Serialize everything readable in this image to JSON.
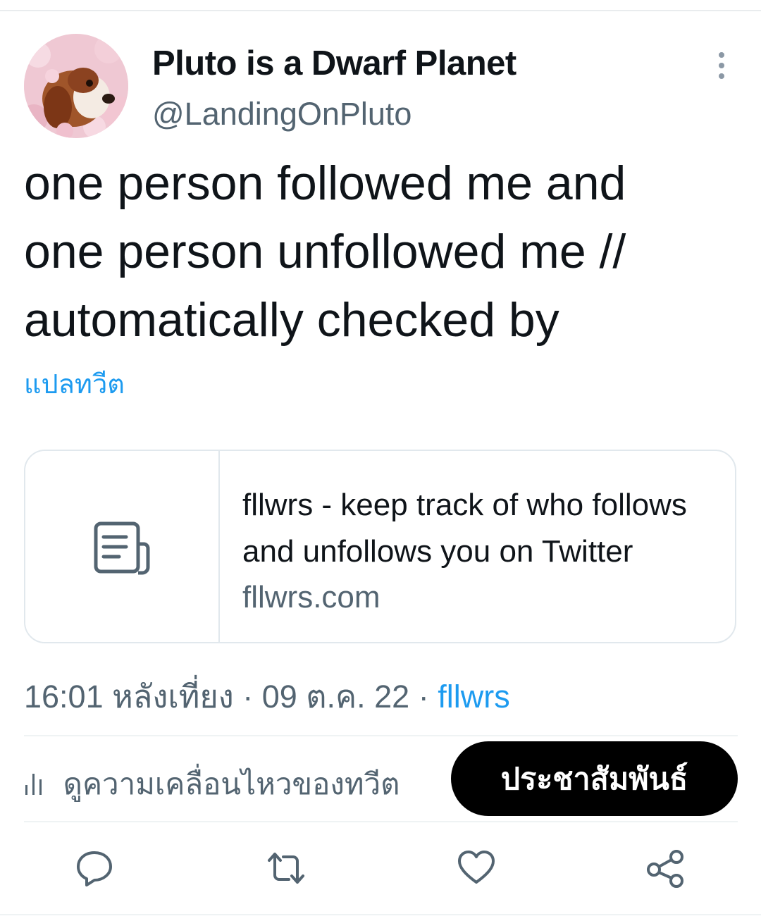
{
  "tweet": {
    "author": {
      "display_name": "Pluto is a Dwarf Planet",
      "handle": "@LandingOnPluto",
      "avatar_icon": "dog-avatar"
    },
    "text": "one person followed me and\none person unfollowed me //\nautomatically checked by",
    "translate_label": "แปลทวีต",
    "card": {
      "icon": "document-icon",
      "title": "fllwrs - keep track of who follows and unfollows you on Twitter",
      "domain": "fllwrs.com"
    },
    "meta": {
      "time": "16:01 หลังเที่ยง",
      "separator": "·",
      "date": "09 ต.ค. 22",
      "source": "fllwrs"
    },
    "activity_label": "ดูความเคลื่อนไหวของทวีต",
    "promo_label": "ประชาสัมพันธ์",
    "actions": [
      "reply-icon",
      "retweet-icon",
      "like-icon",
      "share-icon"
    ]
  },
  "colors": {
    "accent": "#1d9bf0",
    "secondary_text": "#536471",
    "text": "#0f1419",
    "border": "#e1e8ed"
  }
}
